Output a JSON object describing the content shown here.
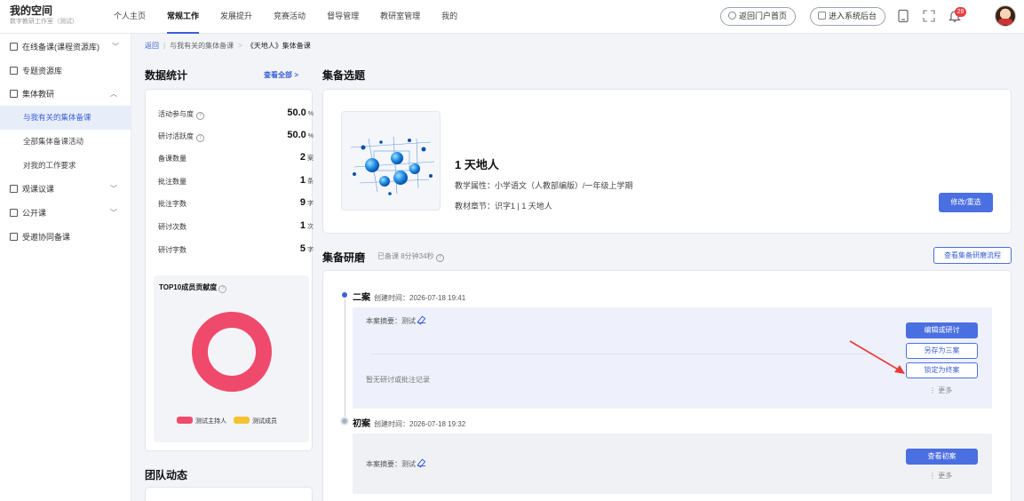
{
  "header": {
    "brand_title": "我的空间",
    "brand_sub": "数字教研工作室（测试）",
    "nav": [
      "个人主页",
      "常规工作",
      "发展提升",
      "竞赛活动",
      "督导管理",
      "教研室管理",
      "我的"
    ],
    "active_nav": "常规工作",
    "portal_btn": "返回门户首页",
    "admin_btn": "进入系统后台",
    "notification_count": "29"
  },
  "sidebar": {
    "item_online": "在线备课(课程资源库)",
    "item_topic": "专题资源库",
    "item_group": "集体教研",
    "sub_related": "与我有关的集体备课",
    "sub_all": "全部集体备课活动",
    "sub_requirement": "对我的工作要求",
    "item_observe": "观课议课",
    "item_public": "公开课",
    "item_invited": "受邀协同备课"
  },
  "breadcrumb": {
    "back": "返回",
    "level1": "与我有关的集体备课",
    "current": "《天地人》集体备课"
  },
  "stats": {
    "title": "数据统计",
    "view_all": "查看全部 >",
    "rows": [
      {
        "label": "活动参与度",
        "value": "50.0",
        "unit": "%",
        "help": true
      },
      {
        "label": "研讨活跃度",
        "value": "50.0",
        "unit": "%",
        "help": true
      },
      {
        "label": "备课数量",
        "value": "2",
        "unit": "案",
        "help": false
      },
      {
        "label": "批注数量",
        "value": "1",
        "unit": "条",
        "help": false
      },
      {
        "label": "批注字数",
        "value": "9",
        "unit": "字",
        "help": false
      },
      {
        "label": "研讨次数",
        "value": "1",
        "unit": "次",
        "help": false
      },
      {
        "label": "研讨字数",
        "value": "5",
        "unit": "字",
        "help": false
      }
    ],
    "contrib_title": "TOP10成员贡献度",
    "legend_host": "测试主持人",
    "legend_member": "测试成员"
  },
  "topic": {
    "title": "集备选题",
    "name": "1 天地人",
    "attr": "教学属性：小学语文（人教部编版）/一年级上学期",
    "chapter": "教材章节：识字1 | 1 天地人",
    "edit_btn": "修改/重选"
  },
  "polish": {
    "title": "集备研磨",
    "elapsed": "已备课 8分钟34秒",
    "flow_btn": "查看集备研磨流程",
    "v2": {
      "name": "二案",
      "created": "创建时间：2026-07-18  19:41",
      "summary": "本案摘要：测试",
      "empty": "暂无研讨或批注记录",
      "btn_edit": "编辑或研讨",
      "btn_save3": "另存为三案",
      "btn_final": "锁定为终案",
      "more": "⋮ 更多"
    },
    "v1": {
      "name": "初案",
      "created": "创建时间：2026-07-18  19:32",
      "summary": "本案摘要：测试",
      "btn_view": "查看初案",
      "more": "⋮ 更多"
    }
  },
  "team": {
    "title": "团队动态"
  },
  "colors": {
    "accent": "#4a6fe0",
    "host": "#ef4a6c",
    "member": "#f5c232"
  }
}
